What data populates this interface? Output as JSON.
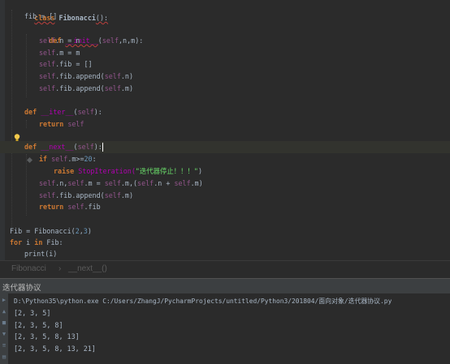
{
  "editor": {
    "lines": {
      "l1": {
        "kw": "class",
        "name": "Fibonacci",
        "rest": "():"
      },
      "l2": {
        "text": "fib = []"
      },
      "l3": {
        "kw": "def",
        "func": "__init__",
        "open": "(",
        "self": "self",
        "p1": ",n,",
        "p2": "m",
        "close": "):"
      },
      "l4": {
        "self": "self",
        "text": ".n = n"
      },
      "l5": {
        "self": "self",
        "text": ".m = m"
      },
      "l6": {
        "self": "self",
        "text": ".fib = []"
      },
      "l7": {
        "self": "self",
        "text": ".fib.append(",
        "arg_self": "self",
        "arg": ".n)"
      },
      "l8": {
        "self": "self",
        "text": ".fib.append(",
        "arg_self": "self",
        "arg": ".m)"
      },
      "l10": {
        "kw": "def",
        "func": "__iter__",
        "open": "(",
        "self": "self",
        "close": "):"
      },
      "l11": {
        "kw": "return",
        "self": "self"
      },
      "l13": {
        "kw": "def",
        "func": "__next__",
        "open": "(",
        "self": "self",
        "close": "):"
      },
      "l14": {
        "kw": "if",
        "self": "self",
        "text": ".m>=",
        "num": "20",
        "colon": ":"
      },
      "l15": {
        "kw": "raise",
        "exc": "StopIteration(",
        "str": "\"迭代器停止！！！\"",
        "close": ")"
      },
      "l16": {
        "self1": "self",
        "t1": ".n,",
        "self2": "self",
        "t2": ".m = ",
        "self3": "self",
        "t3": ".m,(",
        "self4": "self",
        "t4": ".n + ",
        "self5": "self",
        "t5": ".m)"
      },
      "l17": {
        "self": "self",
        "text": ".fib.append(",
        "arg_self": "self",
        "arg": ".m)"
      },
      "l18": {
        "kw": "return",
        "self": "self",
        "text": ".fib"
      },
      "l20": {
        "text": "Fib = Fibonacci(",
        "n1": "2",
        "comma": ",",
        "n2": "3",
        "close": ")"
      },
      "l21": {
        "kw1": "for",
        "mid": " i ",
        "kw2": "in",
        "text": " Fib:"
      },
      "l22": {
        "text": "print(i)"
      }
    }
  },
  "breadcrumb": {
    "class_name": "Fibonacci",
    "separator": "›",
    "method": "__next__()"
  },
  "run_panel": {
    "title": "迭代器协议",
    "command": "D:\\Python35\\python.exe C:/Users/ZhangJ/PycharmProjects/untitled/Python3/201804/面向对象/迭代器协议.py",
    "outputs": [
      "[2, 3, 5]",
      "[2, 3, 5, 8]",
      "[2, 3, 5, 8, 13]",
      "[2, 3, 5, 8, 13, 21]"
    ]
  },
  "colors": {
    "background": "#2b2b2b",
    "keyword": "#cc7832",
    "self": "#94558d",
    "number": "#6897bb",
    "string": "#6a8759",
    "function": "#ffc66d",
    "magic": "#b200b2",
    "text": "#a9b7c6",
    "panel_header": "#3c3f41"
  },
  "icons": {
    "intention": "lightbulb-icon",
    "breakpoint": "breakpoint-icon",
    "rerun": "rerun-icon",
    "stop": "stop-icon",
    "up": "arrow-up-icon",
    "down": "arrow-down-icon",
    "wrap": "soft-wrap-icon",
    "print": "print-icon"
  }
}
